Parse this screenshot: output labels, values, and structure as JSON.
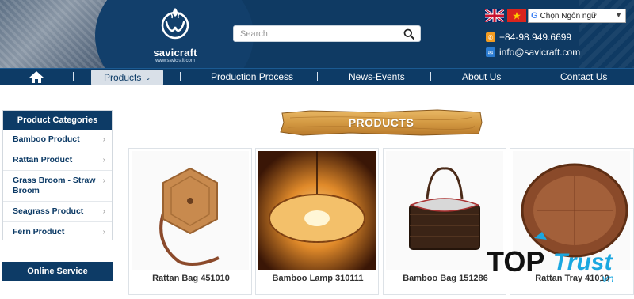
{
  "brand": {
    "name": "savicraft",
    "site": "www.savicraft.com"
  },
  "search": {
    "placeholder": "Search"
  },
  "language": {
    "label": "Chọn Ngôn ngữ",
    "arrow": "▼"
  },
  "contact": {
    "phone": "+84-98.949.6699",
    "email": "info@savicraft.com"
  },
  "nav": {
    "items": [
      "Products",
      "Production Process",
      "News-Events",
      "About Us",
      "Contact Us"
    ],
    "separator": "|"
  },
  "sidebar": {
    "title": "Product Categories",
    "items": [
      "Bamboo Product",
      "Rattan Product",
      "Grass Broom - Straw Broom",
      "Seagrass Product",
      "Fern Product"
    ],
    "online_title": "Online Service"
  },
  "section": {
    "title": "PRODUCTS"
  },
  "products": [
    "Rattan Bag 451010",
    "Bamboo Lamp 310111",
    "Bamboo Bag 151286",
    "Rattan Tray 41010"
  ],
  "watermark": {
    "top": "TOP",
    "trust": "Trust",
    "domain": ".vn"
  },
  "colors": {
    "header": "#0f3a63",
    "nav": "#0d3b66",
    "accent_orange": "#f39c21"
  },
  "icons": [
    "home-icon",
    "search-icon",
    "phone-icon",
    "mail-icon",
    "chevron-right-icon",
    "chevron-down-icon"
  ]
}
